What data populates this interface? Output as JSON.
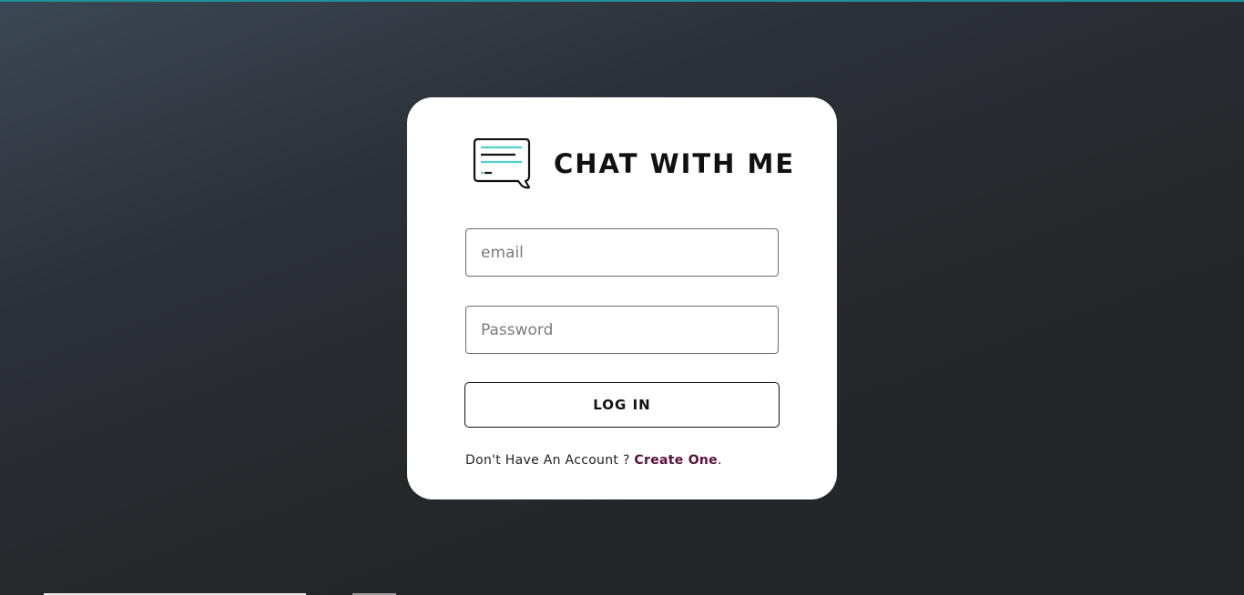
{
  "brand": {
    "title": "CHAT WITH ME",
    "logo_icon": "chat-bubble-icon",
    "accent_color": "#4fcfcb"
  },
  "form": {
    "email_placeholder": "email",
    "password_placeholder": "Password",
    "login_label": "LOG IN"
  },
  "signup": {
    "prompt": "Don't Have An Account ? ",
    "link_label": "Create One",
    "suffix": "."
  },
  "colors": {
    "card_background": "#ffffff",
    "link_color": "#5a0f3c",
    "top_accent": "#1f8f9a"
  }
}
